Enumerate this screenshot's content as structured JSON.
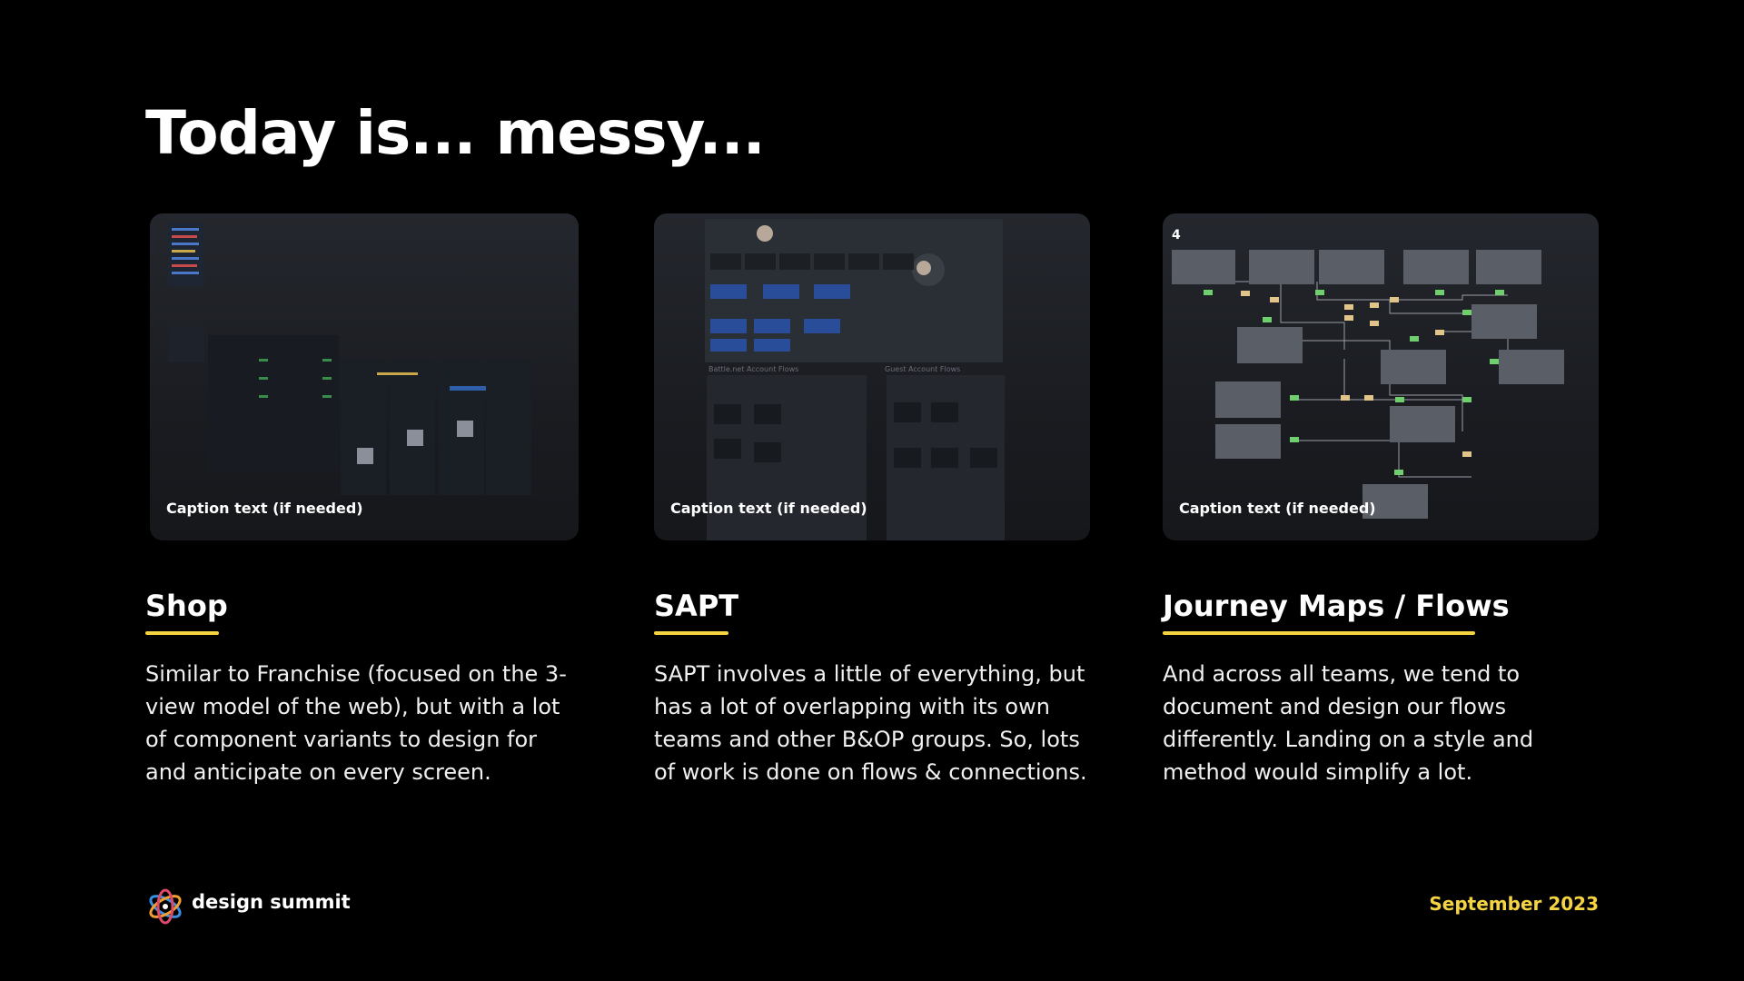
{
  "slide": {
    "title": "Today is... messy..."
  },
  "cards": [
    {
      "caption": "Caption text (if needed)"
    },
    {
      "caption": "Caption text (if needed)",
      "labels": [
        "Battle.net Account Flows",
        "Guest Account Flows"
      ]
    },
    {
      "caption": "Caption text (if needed)",
      "step_number": "4"
    }
  ],
  "columns": [
    {
      "heading": "Shop",
      "body": "Similar to Franchise (focused on the 3-view model of the web), but with a lot of component variants to design for and anticipate on every screen."
    },
    {
      "heading": "SAPT",
      "body": "SAPT involves a little of everything, but has a lot of overlapping with its own teams and other B&OP groups. So, lots of work is done on flows & connections."
    },
    {
      "heading": "Journey Maps / Flows",
      "body": "And across all teams, we tend to document and design our flows differently. Landing on a style and method would simplify a lot."
    }
  ],
  "footer": {
    "brand": "design summit",
    "date": "September 2023",
    "logo_icon": "atom-logo-icon"
  },
  "colors": {
    "background": "#000000",
    "accent": "#f5d442",
    "text": "#ffffff"
  }
}
